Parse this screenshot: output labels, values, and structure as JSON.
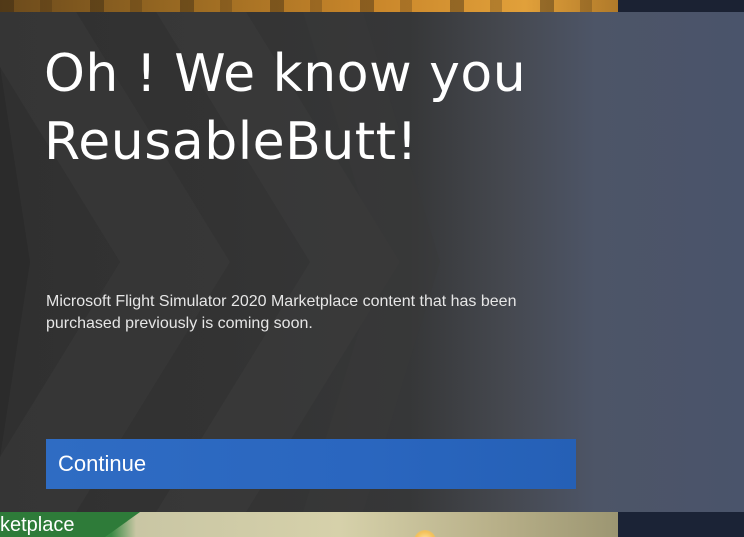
{
  "background": {
    "bottom_card_label": "ketplace"
  },
  "dialog": {
    "title": "Oh ! We know you ReusableButt!",
    "message": "Microsoft Flight Simulator 2020 Marketplace content that has been purchased previously is coming soon.",
    "continue_label": "Continue"
  },
  "colors": {
    "accent": "#2a66bf",
    "dialog_bg": "#333333",
    "text": "#ffffff"
  }
}
